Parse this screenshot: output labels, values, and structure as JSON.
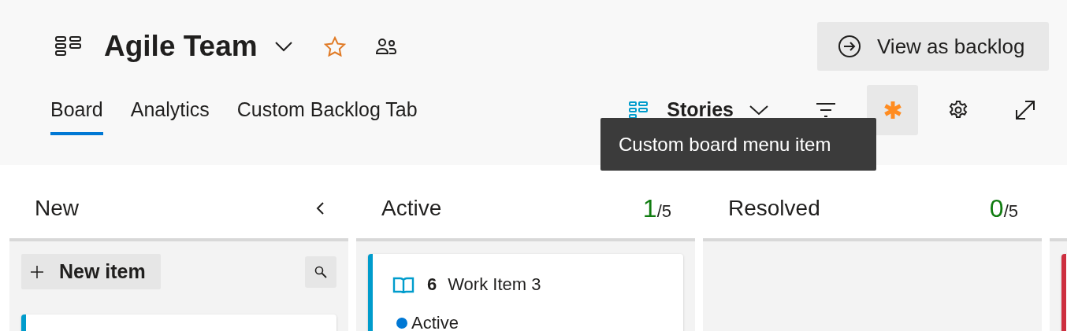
{
  "header": {
    "title": "Agile Team",
    "favorite": true,
    "view_button": "View as backlog"
  },
  "tabs": [
    {
      "label": "Board",
      "selected": true
    },
    {
      "label": "Analytics",
      "selected": false
    },
    {
      "label": "Custom Backlog Tab",
      "selected": false
    }
  ],
  "toolbar": {
    "backlog_level": "Stories",
    "custom_item_highlighted": true,
    "tooltip": "Custom board menu item"
  },
  "columns": [
    {
      "name": "New",
      "collapse": true,
      "new_item": "New item",
      "cards": [
        {
          "color": "#009ccc"
        }
      ]
    },
    {
      "name": "Active",
      "count": "1",
      "limit": "/5",
      "cards": [
        {
          "color": "#009ccc",
          "id": "6",
          "title": "Work Item 3",
          "state": {
            "label": "Active",
            "color": "#0078d4"
          }
        }
      ]
    },
    {
      "name": "Resolved",
      "count": "0",
      "limit": "/5"
    },
    {
      "cards": [
        {
          "color": "#cd2e3f"
        }
      ]
    }
  ]
}
